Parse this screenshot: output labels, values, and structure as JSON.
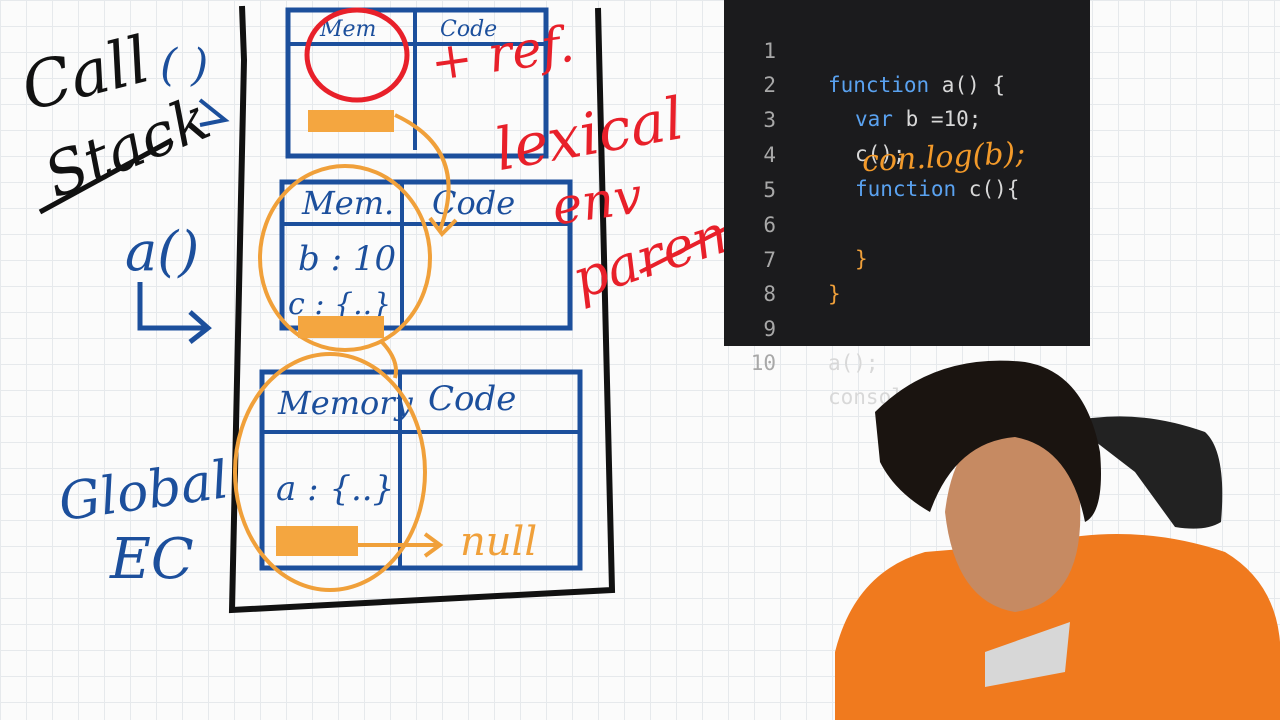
{
  "labels": {
    "call_stack_1": "Call",
    "call_stack_2": "Stack",
    "call_stack_paren": "( )",
    "a_call": "a()",
    "global_1": "Global",
    "global_2": "EC",
    "ref": "+ ref.",
    "lexical": "lexical",
    "env": "env",
    "parent": "parent",
    "null": "null"
  },
  "contexts": {
    "c_ctx": {
      "memory": "Mem",
      "code": "Code"
    },
    "a_ctx": {
      "memory": "Mem.",
      "code": "Code",
      "vars": [
        "b : 10",
        "c : {..}"
      ]
    },
    "global_ctx": {
      "memory": "Memory",
      "code": "Code",
      "vars": [
        "a : {..}"
      ]
    }
  },
  "code": {
    "lines": [
      {
        "num": "1",
        "kw": "function",
        "rest": " a() {",
        "indent": 0
      },
      {
        "num": "2",
        "kw": "var",
        "rest": " b =10;",
        "indent": 1
      },
      {
        "num": "3",
        "kw": "",
        "rest": "c();",
        "indent": 1
      },
      {
        "num": "4",
        "kw": "function",
        "rest": " c(){",
        "indent": 1
      },
      {
        "num": "5",
        "kw": "",
        "rest": "",
        "indent": 2
      },
      {
        "num": "6",
        "kw": "",
        "rest": "}",
        "indent": 1
      },
      {
        "num": "7",
        "kw": "",
        "rest": "}",
        "indent": 0
      },
      {
        "num": "8",
        "kw": "",
        "rest": "",
        "indent": 0
      },
      {
        "num": "9",
        "kw": "",
        "rest": "a();",
        "indent": 0
      },
      {
        "num": "10",
        "kw": "",
        "rest": "console.log(b);",
        "indent": 0
      }
    ],
    "annotation": "con.log(b);"
  },
  "colors": {
    "ink_black": "#111111",
    "ink_blue": "#1c4f9c",
    "ink_red": "#e8202a",
    "ink_orange": "#f0a03a",
    "highlight": "#f4a640",
    "keyword": "#5aa2f0"
  }
}
